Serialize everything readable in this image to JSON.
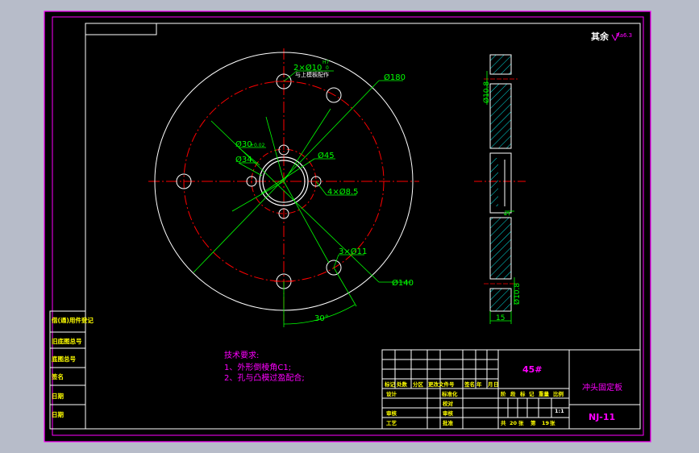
{
  "colors": {
    "background": "#000000",
    "frame": "#ff00ff",
    "outline": "#ffffff",
    "centerline": "#ff0000",
    "dimension": "#00ff00",
    "hatch": "#00ffff",
    "annotation_yellow": "#ffff00"
  },
  "roughness_note": {
    "label": "其余",
    "value": "Ra6.3"
  },
  "front_view": {
    "dims": {
      "holes_2": "2×Ø10",
      "tol_h7": "H7",
      "tol_0": "0",
      "with_die": "与上模板配作",
      "d180": "Ø180",
      "d30": "Ø30",
      "d30_tol": "+0.02",
      "d34": "Ø34",
      "d45": "Ø45",
      "holes_4": "4×Ø8.5",
      "holes_3": "3×Ø11",
      "d140": "Ø140",
      "angle": "30°"
    }
  },
  "side_view": {
    "dims": {
      "top_hole": "Ø10.8",
      "bottom_hole": "Ø10.8",
      "thickness": "15",
      "step": "5"
    }
  },
  "tech_requirements": {
    "title": "技术要求:",
    "items": [
      "1、外形倒棱角C1;",
      "2、孔与凸模过盈配合;"
    ]
  },
  "left_strip": {
    "labels": [
      "借(通)用件登记",
      "旧底图总号",
      "底图总号",
      "签名",
      "日期",
      "日期"
    ]
  },
  "title_block": {
    "material": "45#",
    "part_name": "冲头固定板",
    "drawing_no": "NJ-11",
    "header_cols": [
      "标记",
      "处数",
      "分区",
      "更改文件号",
      "签名",
      "年",
      "月",
      "日"
    ],
    "roles": [
      "设计",
      "审核",
      "工艺"
    ],
    "sub_labels": [
      "标准化",
      "批准"
    ],
    "mid_labels": [
      "校对",
      "审核",
      "批准"
    ],
    "stage_labels": [
      "阶",
      "段",
      "标",
      "记",
      "重量",
      "比例"
    ],
    "scale": "1:1",
    "sheets_total_label": "共",
    "sheets_total": "20",
    "sheets_unit": "张",
    "sheet_label": "第",
    "sheet_no": "19",
    "sheet_unit": "张"
  }
}
